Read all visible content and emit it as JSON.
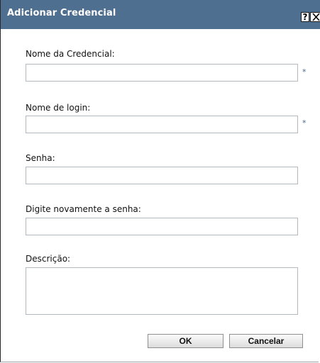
{
  "dialog": {
    "title": "Adicionar Credencial",
    "help_label": "?",
    "close_label": "✕"
  },
  "fields": {
    "credential_name": {
      "label": "Nome da Credencial:",
      "value": "",
      "required_marker": "*"
    },
    "login_name": {
      "label": "Nome de login:",
      "value": "",
      "required_marker": "*"
    },
    "password": {
      "label": "Senha:",
      "value": ""
    },
    "confirm_password": {
      "label": "Digite novamente a senha:",
      "value": ""
    },
    "description": {
      "label": "Descrição:",
      "value": ""
    }
  },
  "buttons": {
    "ok_label": "OK",
    "cancel_label": "Cancelar"
  },
  "colors": {
    "titlebar": "#4f6f91",
    "required_marker": "#4a6a8c"
  }
}
